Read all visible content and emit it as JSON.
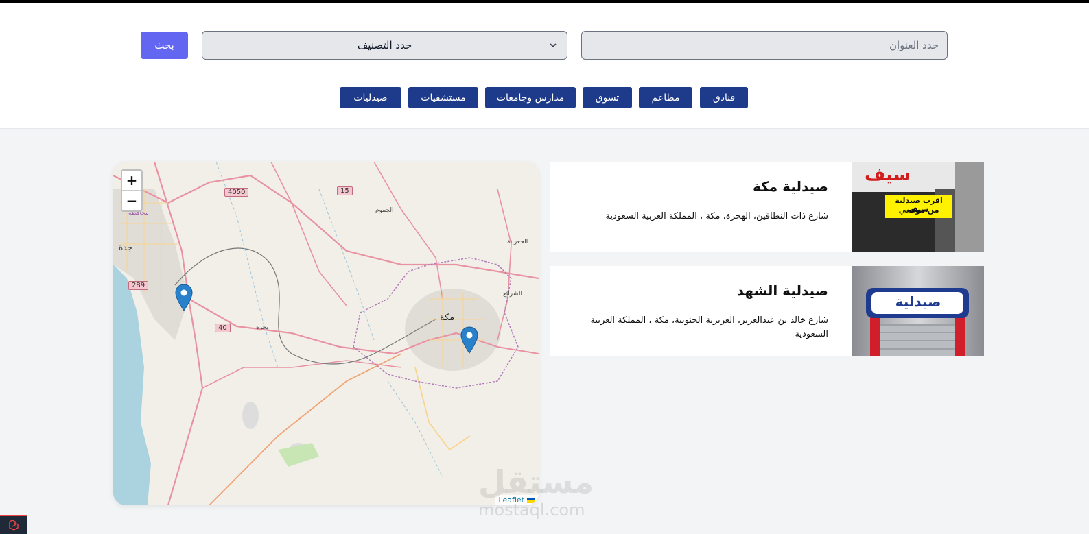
{
  "header": {
    "search_label": "بحث",
    "category_placeholder": "حدد التصنيف",
    "address_placeholder": "حدد العنوان"
  },
  "categories": [
    {
      "label": "فنادق"
    },
    {
      "label": "مطاعم"
    },
    {
      "label": "تسوق"
    },
    {
      "label": "مدارس وجامعات"
    },
    {
      "label": "مستشفيات"
    },
    {
      "label": "صيدليات"
    }
  ],
  "map": {
    "zoom_in": "+",
    "zoom_out": "−",
    "attribution": "Leaflet",
    "labels": {
      "jeddah": "جدة",
      "makkah": "مكة",
      "bahra": "بحرة",
      "jumum": "الجموم",
      "jiranah": "الجعرانة",
      "sharaie": "الشرائع",
      "muhafazah": "محافظة"
    },
    "route_shields": [
      "4050",
      "15",
      "289",
      "40"
    ]
  },
  "results": [
    {
      "name": "صيدلية مكة",
      "address": "شارع ذات النطاقين، الهجرة، مكة ، المملكة العربية السعودية",
      "thumb_sign_top": "سيف",
      "thumb_sign_line1": "اقرب صيدلية سيف",
      "thumb_sign_line2": "من موقعي"
    },
    {
      "name": "صيدلية الشهد",
      "address": "شارع خالد بن عبدالعزيز، العزيزية الجنوبية، مكة ، المملكة العربية السعودية",
      "thumb_sign_top": "صيدلية"
    }
  ],
  "watermark": {
    "arabic": "مستقل",
    "latin": "mostaql.com"
  },
  "colors": {
    "search_button": "#6366f1",
    "category_button": "#1e3a8a",
    "marker": "#2a81cb"
  }
}
